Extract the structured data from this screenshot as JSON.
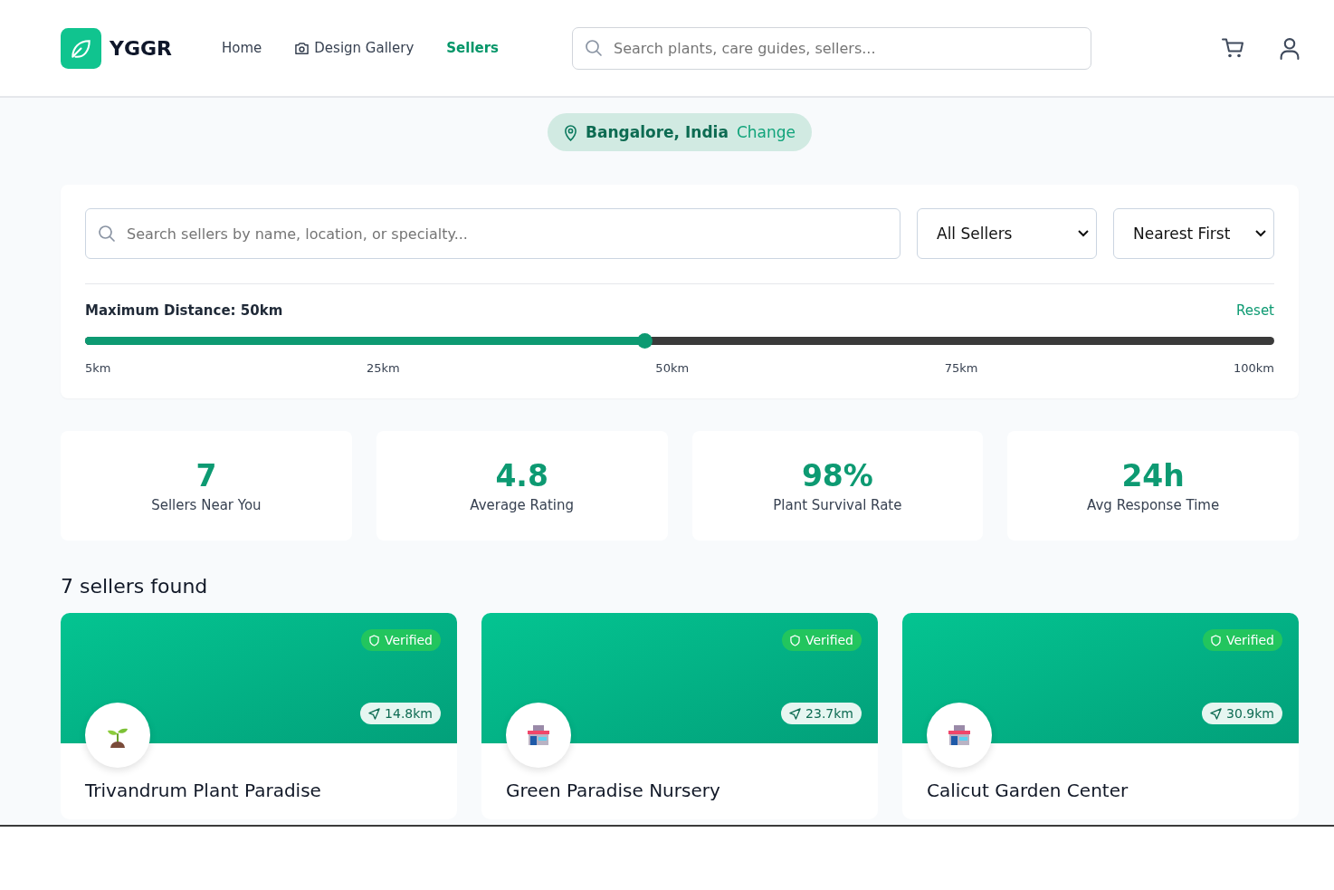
{
  "header": {
    "brand": "YGGR",
    "nav": [
      {
        "label": "Home",
        "kind": "plain",
        "selected": false
      },
      {
        "label": "Design Gallery",
        "kind": "gallery",
        "selected": false
      },
      {
        "label": "Sellers",
        "kind": "plain",
        "selected": true
      }
    ],
    "search": {
      "placeholder": "Search plants, care guides, sellers..."
    }
  },
  "location": {
    "place": "Bangalore, India",
    "action": "Change"
  },
  "filters": {
    "search": {
      "placeholder": "Search sellers by name, location, or specialty..."
    },
    "type_select": "All Sellers",
    "sort_select": "Nearest First",
    "distance": {
      "label": "Maximum Distance: 50km",
      "reset": "Reset",
      "level": 0.47,
      "ticks": [
        "5km",
        "25km",
        "50km",
        "75km",
        "100km"
      ]
    }
  },
  "stats": [
    {
      "value": "7",
      "label": "Sellers Near You"
    },
    {
      "value": "4.8",
      "label": "Average Rating"
    },
    {
      "value": "98%",
      "label": "Plant Survival Rate"
    },
    {
      "value": "24h",
      "label": "Avg Response Time"
    }
  ],
  "results_title": "7 sellers found",
  "sellers": [
    {
      "name": "Trivandrum Plant Paradise",
      "verified": true,
      "badge": "Verified",
      "distance": "14.8km",
      "kind": "seedling"
    },
    {
      "name": "Green Paradise Nursery",
      "verified": true,
      "badge": "Verified",
      "distance": "23.7km",
      "kind": "store"
    },
    {
      "name": "Calicut Garden Center",
      "verified": true,
      "badge": "Verified",
      "distance": "30.9km",
      "kind": "store"
    }
  ]
}
